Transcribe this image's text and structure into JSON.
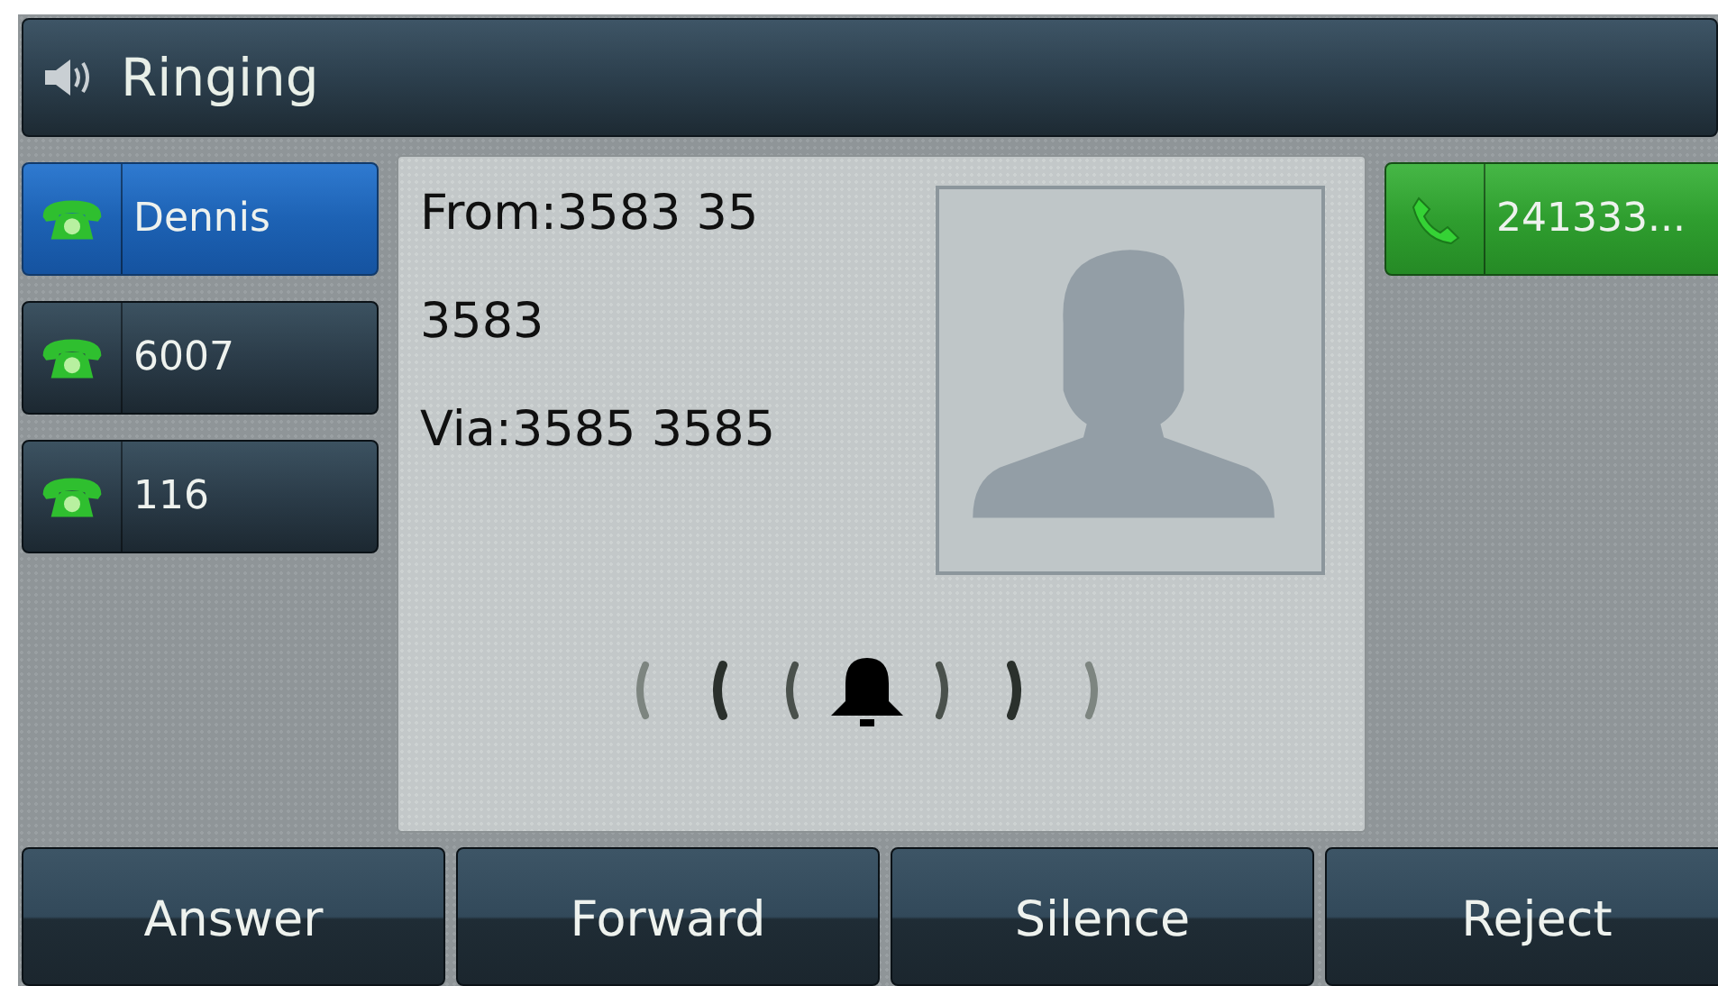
{
  "title_bar": {
    "title": "Ringing"
  },
  "left_line_keys": [
    {
      "label": "Dennis",
      "kind": "ringing",
      "selected": true
    },
    {
      "label": "6007",
      "kind": "ringing",
      "selected": false
    },
    {
      "label": "116",
      "kind": "ringing",
      "selected": false
    }
  ],
  "call_info": {
    "lines": [
      "From:3583 35",
      "3583",
      "Via:3585 3585"
    ]
  },
  "right_line_keys": [
    {
      "label": "241333...",
      "kind": "call"
    }
  ],
  "softkeys": [
    "Answer",
    "Forward",
    "Silence",
    "Reject"
  ]
}
